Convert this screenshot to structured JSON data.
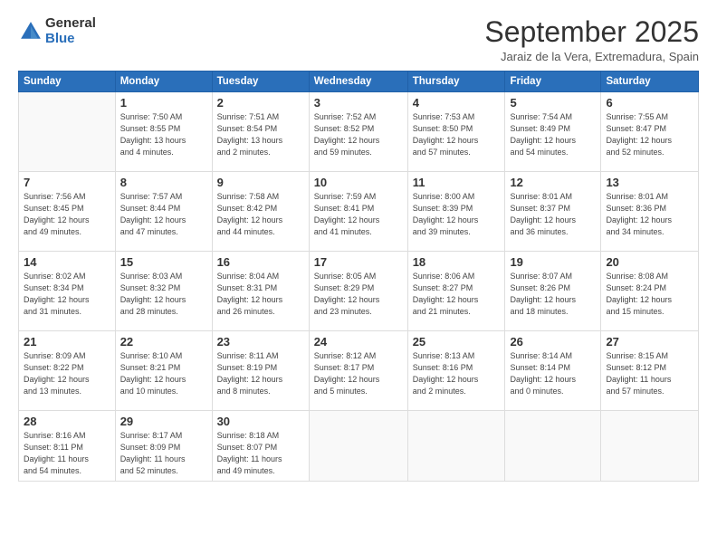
{
  "logo": {
    "general": "General",
    "blue": "Blue"
  },
  "header": {
    "month": "September 2025",
    "location": "Jaraiz de la Vera, Extremadura, Spain"
  },
  "weekdays": [
    "Sunday",
    "Monday",
    "Tuesday",
    "Wednesday",
    "Thursday",
    "Friday",
    "Saturday"
  ],
  "weeks": [
    [
      {
        "day": "",
        "info": ""
      },
      {
        "day": "1",
        "info": "Sunrise: 7:50 AM\nSunset: 8:55 PM\nDaylight: 13 hours\nand 4 minutes."
      },
      {
        "day": "2",
        "info": "Sunrise: 7:51 AM\nSunset: 8:54 PM\nDaylight: 13 hours\nand 2 minutes."
      },
      {
        "day": "3",
        "info": "Sunrise: 7:52 AM\nSunset: 8:52 PM\nDaylight: 12 hours\nand 59 minutes."
      },
      {
        "day": "4",
        "info": "Sunrise: 7:53 AM\nSunset: 8:50 PM\nDaylight: 12 hours\nand 57 minutes."
      },
      {
        "day": "5",
        "info": "Sunrise: 7:54 AM\nSunset: 8:49 PM\nDaylight: 12 hours\nand 54 minutes."
      },
      {
        "day": "6",
        "info": "Sunrise: 7:55 AM\nSunset: 8:47 PM\nDaylight: 12 hours\nand 52 minutes."
      }
    ],
    [
      {
        "day": "7",
        "info": "Sunrise: 7:56 AM\nSunset: 8:45 PM\nDaylight: 12 hours\nand 49 minutes."
      },
      {
        "day": "8",
        "info": "Sunrise: 7:57 AM\nSunset: 8:44 PM\nDaylight: 12 hours\nand 47 minutes."
      },
      {
        "day": "9",
        "info": "Sunrise: 7:58 AM\nSunset: 8:42 PM\nDaylight: 12 hours\nand 44 minutes."
      },
      {
        "day": "10",
        "info": "Sunrise: 7:59 AM\nSunset: 8:41 PM\nDaylight: 12 hours\nand 41 minutes."
      },
      {
        "day": "11",
        "info": "Sunrise: 8:00 AM\nSunset: 8:39 PM\nDaylight: 12 hours\nand 39 minutes."
      },
      {
        "day": "12",
        "info": "Sunrise: 8:01 AM\nSunset: 8:37 PM\nDaylight: 12 hours\nand 36 minutes."
      },
      {
        "day": "13",
        "info": "Sunrise: 8:01 AM\nSunset: 8:36 PM\nDaylight: 12 hours\nand 34 minutes."
      }
    ],
    [
      {
        "day": "14",
        "info": "Sunrise: 8:02 AM\nSunset: 8:34 PM\nDaylight: 12 hours\nand 31 minutes."
      },
      {
        "day": "15",
        "info": "Sunrise: 8:03 AM\nSunset: 8:32 PM\nDaylight: 12 hours\nand 28 minutes."
      },
      {
        "day": "16",
        "info": "Sunrise: 8:04 AM\nSunset: 8:31 PM\nDaylight: 12 hours\nand 26 minutes."
      },
      {
        "day": "17",
        "info": "Sunrise: 8:05 AM\nSunset: 8:29 PM\nDaylight: 12 hours\nand 23 minutes."
      },
      {
        "day": "18",
        "info": "Sunrise: 8:06 AM\nSunset: 8:27 PM\nDaylight: 12 hours\nand 21 minutes."
      },
      {
        "day": "19",
        "info": "Sunrise: 8:07 AM\nSunset: 8:26 PM\nDaylight: 12 hours\nand 18 minutes."
      },
      {
        "day": "20",
        "info": "Sunrise: 8:08 AM\nSunset: 8:24 PM\nDaylight: 12 hours\nand 15 minutes."
      }
    ],
    [
      {
        "day": "21",
        "info": "Sunrise: 8:09 AM\nSunset: 8:22 PM\nDaylight: 12 hours\nand 13 minutes."
      },
      {
        "day": "22",
        "info": "Sunrise: 8:10 AM\nSunset: 8:21 PM\nDaylight: 12 hours\nand 10 minutes."
      },
      {
        "day": "23",
        "info": "Sunrise: 8:11 AM\nSunset: 8:19 PM\nDaylight: 12 hours\nand 8 minutes."
      },
      {
        "day": "24",
        "info": "Sunrise: 8:12 AM\nSunset: 8:17 PM\nDaylight: 12 hours\nand 5 minutes."
      },
      {
        "day": "25",
        "info": "Sunrise: 8:13 AM\nSunset: 8:16 PM\nDaylight: 12 hours\nand 2 minutes."
      },
      {
        "day": "26",
        "info": "Sunrise: 8:14 AM\nSunset: 8:14 PM\nDaylight: 12 hours\nand 0 minutes."
      },
      {
        "day": "27",
        "info": "Sunrise: 8:15 AM\nSunset: 8:12 PM\nDaylight: 11 hours\nand 57 minutes."
      }
    ],
    [
      {
        "day": "28",
        "info": "Sunrise: 8:16 AM\nSunset: 8:11 PM\nDaylight: 11 hours\nand 54 minutes."
      },
      {
        "day": "29",
        "info": "Sunrise: 8:17 AM\nSunset: 8:09 PM\nDaylight: 11 hours\nand 52 minutes."
      },
      {
        "day": "30",
        "info": "Sunrise: 8:18 AM\nSunset: 8:07 PM\nDaylight: 11 hours\nand 49 minutes."
      },
      {
        "day": "",
        "info": ""
      },
      {
        "day": "",
        "info": ""
      },
      {
        "day": "",
        "info": ""
      },
      {
        "day": "",
        "info": ""
      }
    ]
  ]
}
